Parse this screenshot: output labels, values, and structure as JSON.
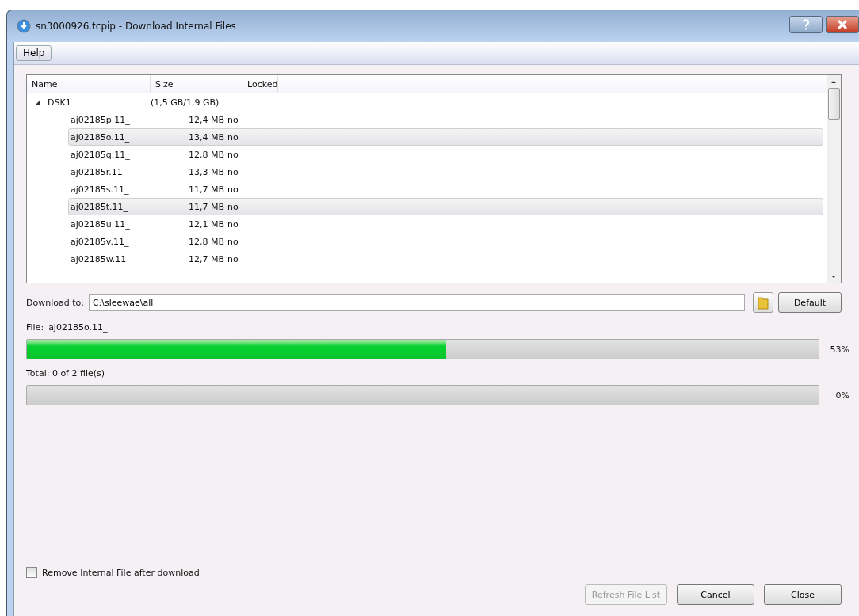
{
  "window": {
    "title": "sn3000926.tcpip - Download Internal Files"
  },
  "menu": [
    {
      "label": "Help"
    }
  ],
  "tree": {
    "columns": [
      "Name",
      "Size",
      "Locked"
    ],
    "items": [
      {
        "name": "DSK1",
        "size": "(1,5 GB/1,9 GB)",
        "expanded": true,
        "children": [
          {
            "name": "aj02185p.11_",
            "size": "12,4 MB",
            "locked": "no",
            "selected": false
          },
          {
            "name": "aj02185o.11_",
            "size": "13,4 MB",
            "locked": "no",
            "selected": true
          },
          {
            "name": "aj02185q.11_",
            "size": "12,8 MB",
            "locked": "no",
            "selected": false
          },
          {
            "name": "aj02185r.11_",
            "size": "13,3 MB",
            "locked": "no",
            "selected": false
          },
          {
            "name": "aj02185s.11_",
            "size": "11,7 MB",
            "locked": "no",
            "selected": false
          },
          {
            "name": "aj02185t.11_",
            "size": "11,7 MB",
            "locked": "no",
            "selected": true
          },
          {
            "name": "aj02185u.11_",
            "size": "12,1 MB",
            "locked": "no",
            "selected": false
          },
          {
            "name": "aj02185v.11_",
            "size": "12,8 MB",
            "locked": "no",
            "selected": false
          },
          {
            "name": "aj02185w.11",
            "size": "12,7 MB",
            "locked": "no",
            "selected": false
          }
        ]
      }
    ]
  },
  "download_to": {
    "label": "Download to:",
    "value": "C:\\sleewae\\all",
    "default_button": "Default"
  },
  "file_progress": {
    "label": "File:",
    "file": "aj02185o.11_",
    "level": 0.53,
    "reading": "53%"
  },
  "total_progress": {
    "label": "Total: 0 of 2 file(s)",
    "level": 0,
    "reading": "0%"
  },
  "remove_option": {
    "label": "Remove Internal File after download",
    "checked": false
  },
  "buttons": [
    {
      "label": "Refresh File List",
      "disabled": true
    },
    {
      "label": "Cancel",
      "disabled": false
    },
    {
      "label": "Close",
      "disabled": false
    }
  ]
}
